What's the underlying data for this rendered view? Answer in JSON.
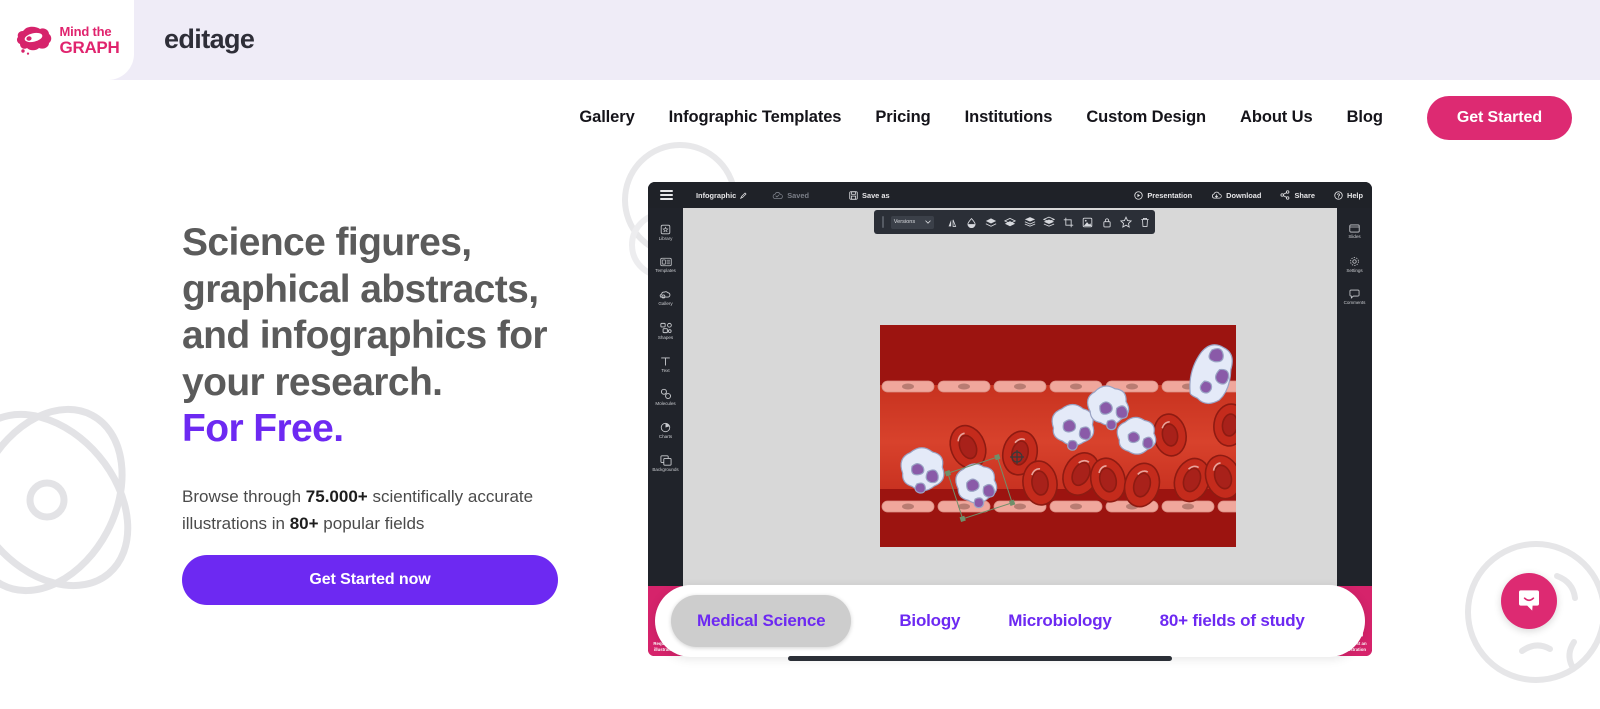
{
  "header": {
    "logo": {
      "line1": "Mind the",
      "line2": "GRAPH",
      "icon": "brain-logo-icon",
      "color": "#e0246e"
    },
    "brand_name": "editage"
  },
  "nav": {
    "items": [
      {
        "label": "Gallery",
        "name": "nav-item-gallery"
      },
      {
        "label": "Infographic Templates",
        "name": "nav-item-infographic-templates"
      },
      {
        "label": "Pricing",
        "name": "nav-item-pricing"
      },
      {
        "label": "Institutions",
        "name": "nav-item-institutions"
      },
      {
        "label": "Custom Design",
        "name": "nav-item-custom-design"
      },
      {
        "label": "About Us",
        "name": "nav-item-about-us"
      },
      {
        "label": "Blog",
        "name": "nav-item-blog"
      }
    ],
    "cta_label": "Get Started",
    "cta_color": "#dd2a72"
  },
  "hero": {
    "title_line1": "Science figures,",
    "title_line2": "graphical abstracts,",
    "title_line3": "and infographics for",
    "title_line4": "your research.",
    "title_highlight": "For Free.",
    "highlight_color": "#6d29f2",
    "sub_pre": "Browse through ",
    "sub_bold1": "75.000+",
    "sub_mid": " scientifically accurate illustrations in ",
    "sub_bold2": "80+",
    "sub_post": " popular fields",
    "cta_label": "Get Started now",
    "cta_color": "#6d29f2"
  },
  "app": {
    "topbar": {
      "menu_icon": "hamburger-icon",
      "doc_title": "Infographic",
      "edit_icon": "pencil-icon",
      "saved_label": "Saved",
      "saved_icon": "cloud-check-icon",
      "save_as_label": "Save as",
      "save_as_icon": "floppy-disk-icon",
      "right_items": [
        {
          "label": "Presentation",
          "icon": "play-circle-icon"
        },
        {
          "label": "Download",
          "icon": "cloud-download-icon"
        },
        {
          "label": "Share",
          "icon": "share-nodes-icon"
        },
        {
          "label": "Help",
          "icon": "question-circle-icon"
        }
      ]
    },
    "left_sidebar": [
      {
        "label": "Library",
        "icon": "library-star-icon"
      },
      {
        "label": "Templates",
        "icon": "templates-icon"
      },
      {
        "label": "Gallery",
        "icon": "gallery-cloud-icon"
      },
      {
        "label": "Shapes",
        "icon": "shapes-icon"
      },
      {
        "label": "Text",
        "icon": "text-t-icon"
      },
      {
        "label": "Molecules",
        "icon": "molecules-icon"
      },
      {
        "label": "Charts",
        "icon": "pie-chart-icon"
      },
      {
        "label": "Backgrounds",
        "icon": "backgrounds-icon"
      }
    ],
    "right_sidebar": [
      {
        "label": "Slides",
        "icon": "slides-icon"
      },
      {
        "label": "Settings",
        "icon": "gear-icon"
      },
      {
        "label": "Comments",
        "icon": "comment-icon"
      }
    ],
    "float_toolbar": {
      "select_label": "Versions",
      "select_caret": "chevron-down-icon",
      "icons": [
        "flip-horizontal-icon",
        "opacity-icon",
        "bring-forward-icon",
        "send-backward-icon",
        "bring-to-front-icon",
        "send-to-back-icon",
        "crop-icon",
        "mask-icon",
        "lock-icon",
        "favorite-star-icon",
        "delete-trash-icon"
      ]
    },
    "canvas": {
      "illustration_name": "blood-vessel-leukocyte-illustration",
      "cursor_icon": "move-crosshair-icon"
    },
    "request_tab": {
      "line1": "Request an",
      "line2": "illustration",
      "color": "#d6236b"
    }
  },
  "categories": {
    "items": [
      {
        "label": "Medical Science",
        "active": true
      },
      {
        "label": "Biology",
        "active": false
      },
      {
        "label": "Microbiology",
        "active": false
      },
      {
        "label": "80+ fields of study",
        "active": false
      }
    ],
    "text_color": "#6d29f2",
    "active_bg": "#cdcdcd"
  },
  "chat": {
    "icon": "chat-bubble-icon",
    "color": "#dd2a72"
  }
}
